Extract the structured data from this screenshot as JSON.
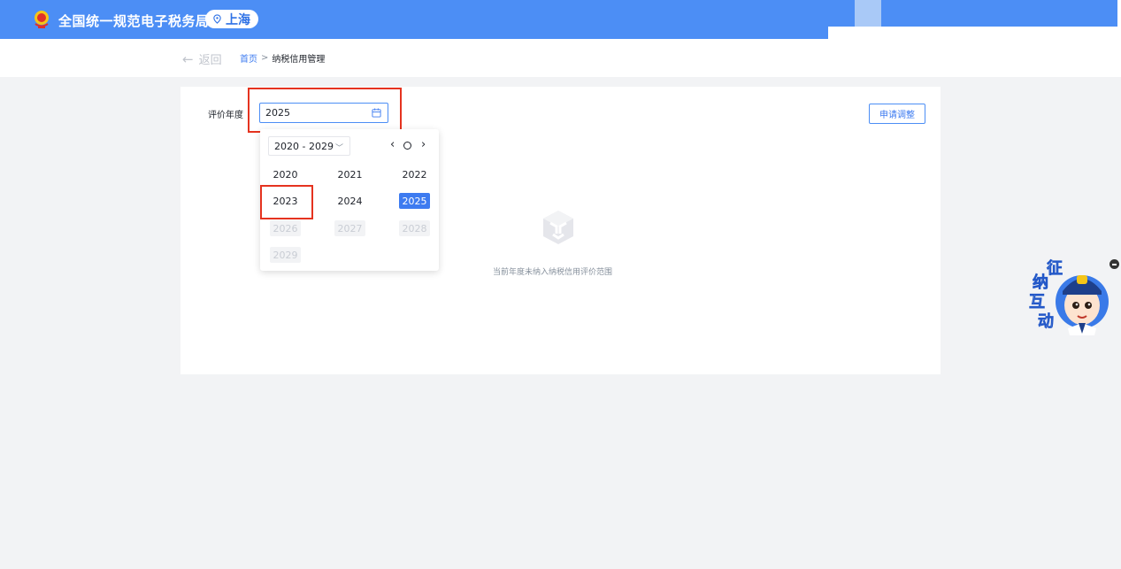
{
  "header": {
    "app_title": "全国统一规范电子税务局",
    "region": "上海",
    "icons": {
      "emblem": "tax-emblem-icon",
      "location": "location-pin-icon"
    }
  },
  "subnav": {
    "back_label": "返回",
    "breadcrumb": {
      "home": "首页",
      "separator": ">",
      "current": "纳税信用管理"
    }
  },
  "form": {
    "year_label": "评价年度",
    "year_value": "2025",
    "apply_button": "申请调整"
  },
  "empty_state": {
    "message": "当前年度未纳入纳税信用评价范围",
    "icon": "empty-box-icon"
  },
  "year_picker": {
    "decade": "2020 - 2029",
    "selected": "2025",
    "years": [
      {
        "label": "2020",
        "state": "normal"
      },
      {
        "label": "2021",
        "state": "normal"
      },
      {
        "label": "2022",
        "state": "normal"
      },
      {
        "label": "2023",
        "state": "normal"
      },
      {
        "label": "2024",
        "state": "normal"
      },
      {
        "label": "2025",
        "state": "selected"
      },
      {
        "label": "2026",
        "state": "disabled"
      },
      {
        "label": "2027",
        "state": "disabled"
      },
      {
        "label": "2028",
        "state": "disabled"
      },
      {
        "label": "2029",
        "state": "disabled"
      }
    ]
  },
  "mascot": {
    "chars": [
      "征",
      "纳",
      "互",
      "动"
    ]
  },
  "colors": {
    "primary": "#4c8ef5",
    "link": "#3d7bf0",
    "annotation_red": "#e5331f",
    "selected_year": "#3d7bf0"
  }
}
